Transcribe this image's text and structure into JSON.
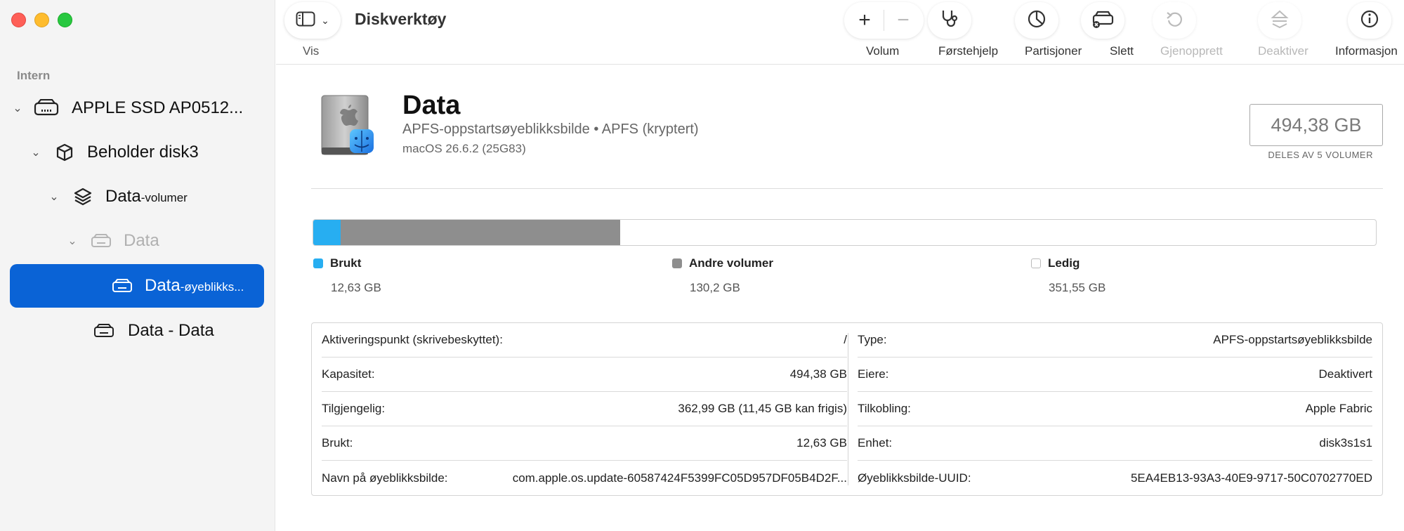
{
  "sidebar": {
    "section": "Intern",
    "items": [
      {
        "label": "APPLE SSD AP0512..."
      },
      {
        "label": "Beholder disk3"
      },
      {
        "label": "Data",
        "suffix": "-volumer"
      },
      {
        "label": "Data"
      },
      {
        "label": "Data",
        "suffix": "-øyeblikks..."
      },
      {
        "label": "Data - Data"
      }
    ]
  },
  "toolbar": {
    "app_title": "Diskverktøy",
    "vis_label": "Vis",
    "volum_label": "Volum",
    "forstehjelp_label": "Førstehjelp",
    "partisjoner_label": "Partisjoner",
    "slett_label": "Slett",
    "gjenopprett_label": "Gjenopprett",
    "deaktiver_label": "Deaktiver",
    "info_label": "Informasjon"
  },
  "volume": {
    "name": "Data",
    "subtitle": "APFS-oppstartsøyeblikksbilde • APFS (kryptert)",
    "os": "macOS 26.6.2 (25G83)",
    "capacity": "494,38 GB",
    "capacity_sub": "DELES AV 5 VOLUMER"
  },
  "usage": {
    "used_fraction": 0.0255,
    "other_fraction": 0.2634,
    "colors": {
      "used": "#27aef1",
      "other": "#8e8e8e",
      "free": "#ffffff"
    },
    "legend": [
      {
        "label": "Brukt",
        "value": "12,63 GB"
      },
      {
        "label": "Andre volumer",
        "value": "130,2 GB"
      },
      {
        "label": "Ledig",
        "value": "351,55 GB"
      }
    ]
  },
  "info": {
    "left": [
      {
        "key": "Aktiveringspunkt (skrivebeskyttet):",
        "value": "/"
      },
      {
        "key": "Kapasitet:",
        "value": "494,38 GB"
      },
      {
        "key": "Tilgjengelig:",
        "value": "362,99 GB (11,45 GB kan frigis)"
      },
      {
        "key": "Brukt:",
        "value": "12,63 GB"
      },
      {
        "key": "Navn på øyeblikksbilde:",
        "value": "com.apple.os.update-60587424F5399FC05D957DF05B4D2F..."
      }
    ],
    "right": [
      {
        "key": "Type:",
        "value": "APFS-oppstartsøyeblikksbilde"
      },
      {
        "key": "Eiere:",
        "value": "Deaktivert"
      },
      {
        "key": "Tilkobling:",
        "value": "Apple Fabric"
      },
      {
        "key": "Enhet:",
        "value": "disk3s1s1"
      },
      {
        "key": "Øyeblikksbilde-UUID:",
        "value": "5EA4EB13-93A3-40E9-9717-50C0702770ED"
      }
    ]
  }
}
